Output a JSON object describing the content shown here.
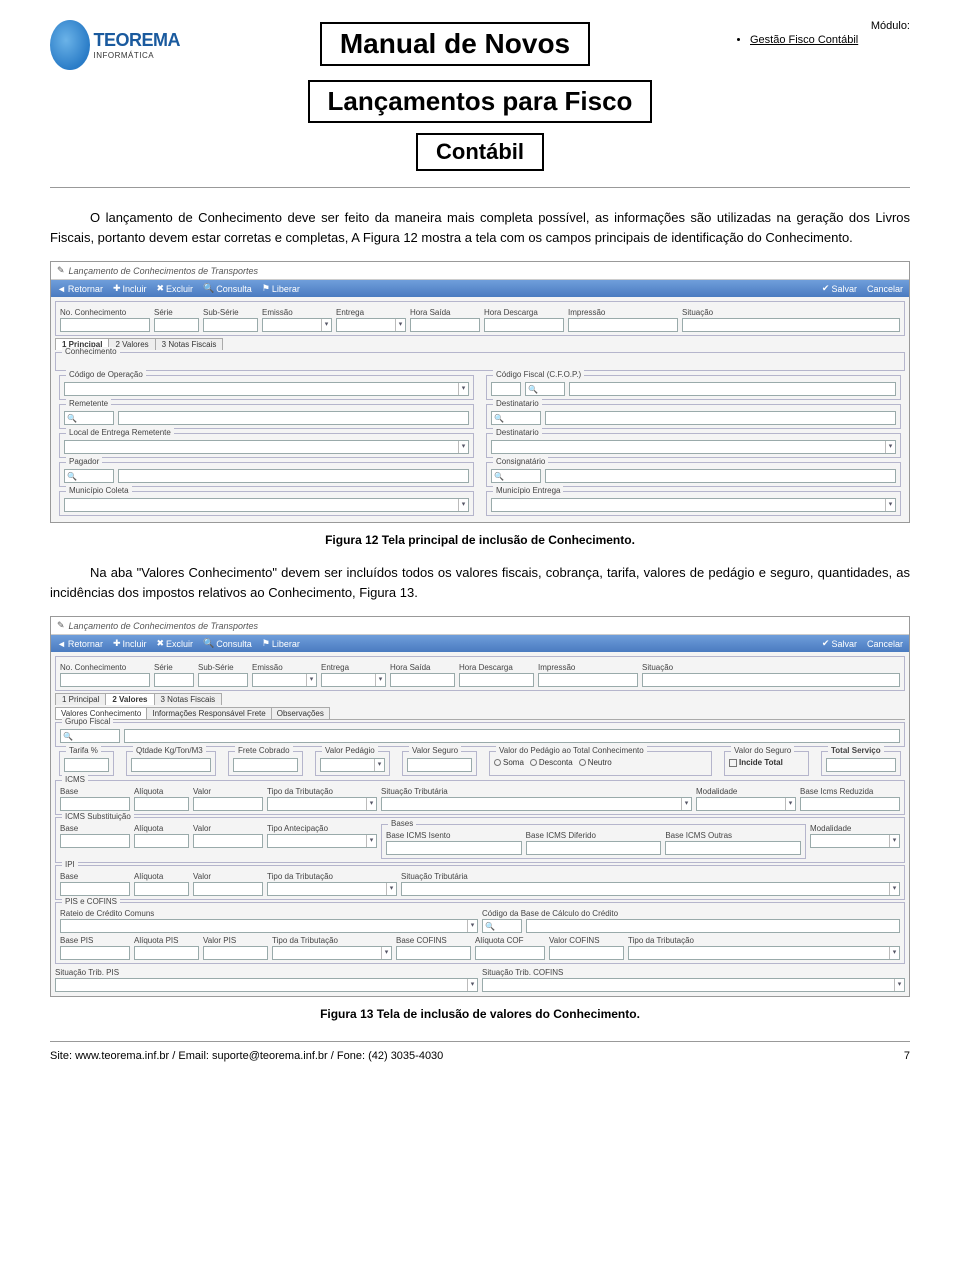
{
  "header": {
    "logo_brand": "TEOREMA",
    "logo_sub": "INFORMÁTICA",
    "title_line1": "Manual de Novos",
    "title_line2": "Lançamentos para Fisco",
    "title_line3": "Contábil",
    "module_label": "Módulo:",
    "module_item": "Gestão Fisco Contábil"
  },
  "para1": "O lançamento de Conhecimento deve ser feito da maneira mais completa possível, as informações são utilizadas na geração dos Livros Fiscais, portanto devem estar corretas e completas, A Figura 12 mostra a tela com os campos principais de identificação do Conhecimento.",
  "fig12": {
    "window_title": "Lançamento de Conhecimentos de Transportes",
    "toolbar": {
      "retornar": "Retornar",
      "incluir": "Incluir",
      "excluir": "Excluir",
      "consulta": "Consulta",
      "liberar": "Liberar",
      "salvar": "Salvar",
      "cancelar": "Cancelar"
    },
    "top_fields": [
      "No. Conhecimento",
      "Série",
      "Sub-Série",
      "Emissão",
      "Entrega",
      "Hora Saída",
      "Hora Descarga",
      "Impressão",
      "Situação"
    ],
    "tabs": [
      "1 Principal",
      "2 Valores",
      "3 Notas Fiscais"
    ],
    "active_tab": 0,
    "fs_conhecimento": "Conhecimento",
    "fields": {
      "codigo_operacao": "Código de Operação",
      "codigo_fiscal": "Código Fiscal (C.F.O.P.)",
      "remetente": "Remetente",
      "destinatario": "Destinatario",
      "local_entrega": "Local de Entrega Remetente",
      "destinatario2": "Destinatario",
      "pagador": "Pagador",
      "consignatario": "Consignatário",
      "municipio_coleta": "Município Coleta",
      "municipio_entrega": "Município Entrega"
    },
    "caption": "Figura 12 Tela principal de inclusão de Conhecimento."
  },
  "para2": "Na aba \"Valores Conhecimento\" devem ser incluídos todos os valores fiscais, cobrança, tarifa, valores de pedágio e seguro, quantidades, as incidências dos impostos relativos ao Conhecimento, Figura 13.",
  "fig13": {
    "window_title": "Lançamento de Conhecimentos de Transportes",
    "toolbar": {
      "retornar": "Retornar",
      "incluir": "Incluir",
      "excluir": "Excluir",
      "consulta": "Consulta",
      "liberar": "Liberar",
      "salvar": "Salvar",
      "cancelar": "Cancelar"
    },
    "top_fields": [
      "No. Conhecimento",
      "Série",
      "Sub-Série",
      "Emissão",
      "Entrega",
      "Hora Saída",
      "Hora Descarga",
      "Impressão",
      "Situação"
    ],
    "tabs": [
      "1 Principal",
      "2 Valores",
      "3 Notas Fiscais"
    ],
    "active_tab": 1,
    "subtabs": [
      "Valores Conhecimento",
      "Informações Responsável Frete",
      "Observações"
    ],
    "fs_grupo": "Grupo Fiscal",
    "row1": {
      "tarifa": "Tarifa %",
      "qtdade": "Qtdade Kg/Ton/M3",
      "frete": "Frete Cobrado",
      "pedagio": "Valor Pedágio",
      "seguro": "Valor Seguro",
      "valor_ped_total": "Valor do Pedágio ao Total Conhecimento",
      "valor_do_seguro": "Valor do Seguro",
      "total": "Total Serviço"
    },
    "radios": {
      "soma": "Soma",
      "desconta": "Desconta",
      "neutro": "Neutro"
    },
    "incide": "Incide Total",
    "icms": {
      "legend": "ICMS",
      "base": "Base",
      "aliquota": "Alíquota",
      "valor": "Valor",
      "tipo": "Tipo da Tributação",
      "situacao": "Situação Tributária",
      "modalidade": "Modalidade",
      "base_red": "Base Icms Reduzida"
    },
    "icms_sub": {
      "legend": "ICMS Substituição",
      "base": "Base",
      "aliquota": "Alíquota",
      "valor": "Valor",
      "tipo": "Tipo Antecipação",
      "bases_legend": "Bases",
      "base_isento": "Base ICMS Isento",
      "base_dif": "Base ICMS Diferido",
      "base_outras": "Base ICMS Outras",
      "modalidade": "Modalidade"
    },
    "ipi": {
      "legend": "IPI",
      "base": "Base",
      "aliquota": "Alíquota",
      "valor": "Valor",
      "tipo": "Tipo da Tributação",
      "situacao": "Situação Tributária"
    },
    "pis": {
      "legend": "PIS e COFINS",
      "rateio": "Rateio de Crédito Comuns",
      "codigo": "Código da Base de Cálculo do Crédito",
      "base_pis": "Base PIS",
      "aliq_pis": "Alíquota PIS",
      "valor_pis": "Valor PIS",
      "tipo_trib": "Tipo da Tributação",
      "base_cof": "Base COFINS",
      "aliq_cof": "Alíquota COF",
      "valor_cof": "Valor COFINS",
      "tipo_trib2": "Tipo da Tributação"
    },
    "sit_pis": "Situação Trib. PIS",
    "sit_cof": "Situação Trib. COFINS",
    "caption": "Figura 13 Tela de inclusão de valores do Conhecimento."
  },
  "footer": {
    "line": "Site: www.teorema.inf.br / Email: suporte@teorema.inf.br / Fone: (42) 3035-4030",
    "page": "7"
  }
}
